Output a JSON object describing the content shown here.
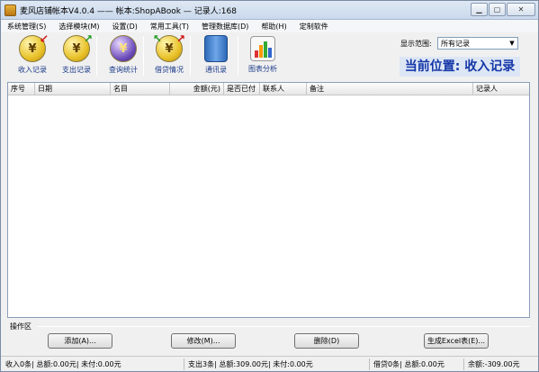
{
  "window": {
    "title": "麦风店铺帐本V4.0.4   ——  帐本:ShopABook — 记录人:168",
    "controls": [
      "minimize",
      "maximize",
      "close"
    ]
  },
  "menu": [
    "系统管理(S)",
    "选择模块(M)",
    "设置(D)",
    "常用工具(T)",
    "管理数据库(D)",
    "帮助(H)",
    "定制软件"
  ],
  "toolbar": {
    "buttons": [
      {
        "label": "收入记录",
        "icon": "income-coin-icon"
      },
      {
        "label": "支出记录",
        "icon": "expense-coin-icon"
      },
      {
        "label": "查询统计",
        "icon": "query-stats-icon"
      },
      {
        "label": "借贷情况",
        "icon": "loan-coin-icon"
      },
      {
        "label": "通讯录",
        "icon": "address-book-icon"
      },
      {
        "label": "图表分析",
        "icon": "chart-analysis-icon"
      }
    ],
    "coin_glyph": "¥",
    "range_label": "显示范围:",
    "range_value": "所有记录",
    "location": "当前位置: 收入记录"
  },
  "table": {
    "columns": [
      "序号",
      "日期",
      "名目",
      "金额(元)",
      "是否已付",
      "联系人",
      "备注",
      "记录人"
    ],
    "rows": []
  },
  "operations": {
    "group_label": "操作区",
    "add": "添加(A)...",
    "edit": "修改(M)...",
    "delete": "删除(D)",
    "excel": "生成Excel表(E)..."
  },
  "status": {
    "income": "收入0条| 总额:0.00元| 未付:0.00元",
    "expense": "支出3条| 总额:309.00元| 未付:0.00元",
    "loan": "借贷0条| 总额:0.00元",
    "balance": "余额:-309.00元"
  },
  "colors": {
    "location_text": "#1437a8",
    "toolbar_label": "#1a3a8a"
  }
}
